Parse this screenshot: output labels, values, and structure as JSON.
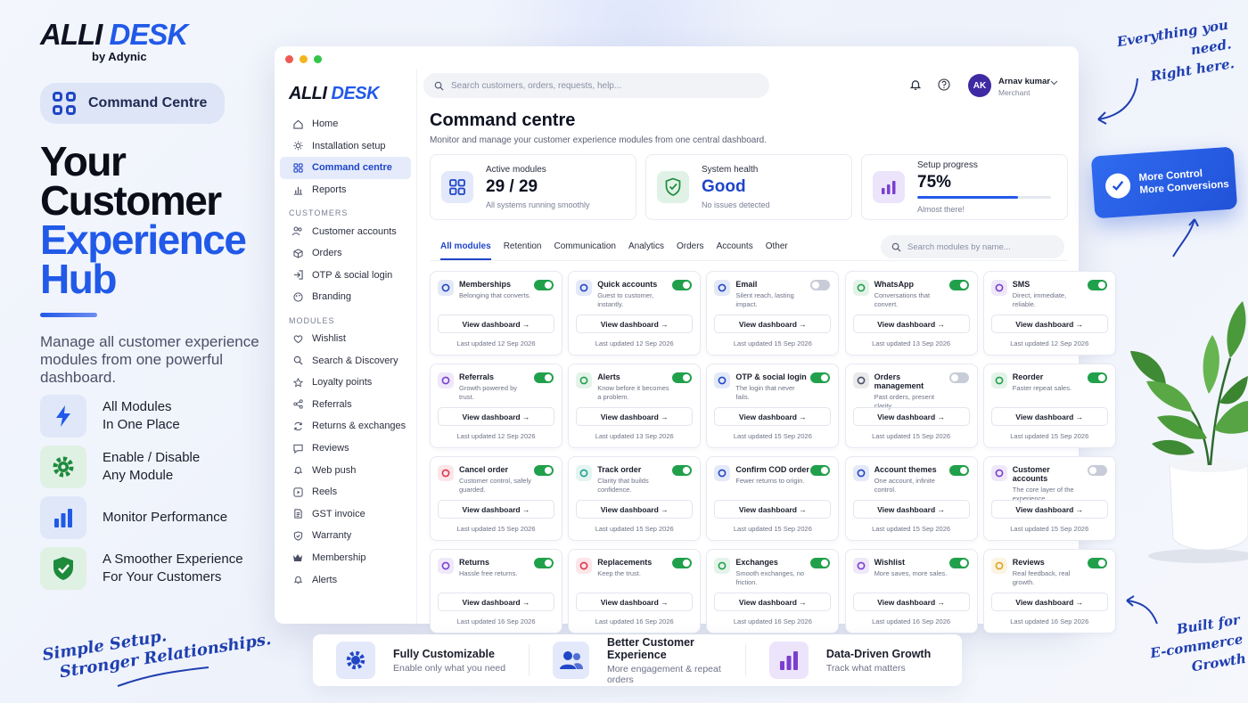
{
  "brand": {
    "logo_a": "ALLI",
    "logo_b": "DESK",
    "byline": "by Adynic"
  },
  "promo": {
    "pill": "Command Centre",
    "headline": [
      "Your",
      "Customer",
      "Experience",
      "Hub"
    ],
    "description": "Manage all customer experience modules from one powerful dashboard.",
    "features": [
      {
        "l1": "All Modules",
        "l2": "In One Place",
        "icon": "bolt-icon"
      },
      {
        "l1": "Enable / Disable",
        "l2": "Any Module",
        "icon": "gear-icon"
      },
      {
        "l1": "Monitor Performance",
        "l2": "",
        "icon": "bar-chart-icon"
      },
      {
        "l1": "A Smoother Experience",
        "l2": "For Your Customers",
        "icon": "shield-check-icon"
      }
    ],
    "script_bottom": [
      "Simple Setup.",
      "Stronger Relationships."
    ],
    "script_top": [
      "Everything you need.",
      "Right here."
    ],
    "script_right": [
      "Built for",
      "E-commerce Growth"
    ]
  },
  "badge": {
    "l1": "More Control",
    "l2": "More Conversions"
  },
  "window": {
    "search_placeholder": "Search customers, orders, requests, help...",
    "user": {
      "initials": "AK",
      "name": "Arnav kumar",
      "role": "Merchant"
    },
    "sidebar": {
      "top": [
        "Home",
        "Installation setup",
        "Command centre",
        "Reports"
      ],
      "customers_label": "CUSTOMERS",
      "customers": [
        "Customer accounts",
        "Orders",
        "OTP & social login",
        "Branding"
      ],
      "modules_label": "MODULES",
      "modules": [
        "Wishlist",
        "Search & Discovery",
        "Loyalty points",
        "Referrals",
        "Returns & exchanges",
        "Reviews",
        "Web push",
        "Reels",
        "GST invoice",
        "Warranty",
        "Membership",
        "Alerts"
      ]
    },
    "title": "Command centre",
    "subtitle": "Monitor and manage your customer experience modules from one central dashboard.",
    "stats": {
      "active": {
        "label": "Active modules",
        "value": "29 / 29",
        "note": "All systems running smoothly"
      },
      "health": {
        "label": "System health",
        "value": "Good",
        "note": "No issues detected"
      },
      "setup": {
        "label": "Setup progress",
        "value": "75%",
        "progress": 0.75,
        "note": "Almost there!"
      }
    },
    "tabs": [
      "All modules",
      "Retention",
      "Communication",
      "Analytics",
      "Orders",
      "Accounts",
      "Other"
    ],
    "module_search_placeholder": "Search modules by name...",
    "view_label": "View dashboard →",
    "modules": [
      {
        "name": "Memberships",
        "desc": "Belonging that converts.",
        "on": true,
        "updated": "Last updated 12 Sep 2026",
        "color": "#2146c6",
        "icon": "crown-icon"
      },
      {
        "name": "Quick accounts",
        "desc": "Guest to customer, instantly.",
        "on": true,
        "updated": "Last updated 12 Sep 2026",
        "color": "#2146c6",
        "icon": "users-icon"
      },
      {
        "name": "Email",
        "desc": "Silent reach, lasting impact.",
        "on": false,
        "updated": "Last updated 15 Sep 2026",
        "color": "#2146c6",
        "icon": "message-icon"
      },
      {
        "name": "WhatsApp",
        "desc": "Conversations that convert.",
        "on": true,
        "updated": "Last updated 13 Sep 2026",
        "color": "#21a04b",
        "icon": "whatsapp-icon"
      },
      {
        "name": "SMS",
        "desc": "Direct, immediate, reliable.",
        "on": true,
        "updated": "Last updated 12 Sep 2026",
        "color": "#7a3fd0",
        "icon": "sms-icon"
      },
      {
        "name": "Referrals",
        "desc": "Growth powered by trust.",
        "on": true,
        "updated": "Last updated 12 Sep 2026",
        "color": "#7a3fd0",
        "icon": "share-icon"
      },
      {
        "name": "Alerts",
        "desc": "Know before it becomes a problem.",
        "on": true,
        "updated": "Last updated 13 Sep 2026",
        "color": "#21a04b",
        "icon": "bell-icon"
      },
      {
        "name": "OTP & social login",
        "desc": "The login that never fails.",
        "on": true,
        "updated": "Last updated 15 Sep 2026",
        "color": "#2146c6",
        "icon": "login-icon"
      },
      {
        "name": "Orders management",
        "desc": "Past orders, present clarity.",
        "on": false,
        "updated": "Last updated 15 Sep 2026",
        "color": "#4a4f66",
        "icon": "box-icon"
      },
      {
        "name": "Reorder",
        "desc": "Faster repeat sales.",
        "on": true,
        "updated": "Last updated 15 Sep 2026",
        "color": "#21a04b",
        "icon": "refresh-icon"
      },
      {
        "name": "Cancel order",
        "desc": "Customer control, safely guarded.",
        "on": true,
        "updated": "Last updated 15 Sep 2026",
        "color": "#e0344a",
        "icon": "cancel-icon"
      },
      {
        "name": "Track order",
        "desc": "Clarity that builds confidence.",
        "on": true,
        "updated": "Last updated 15 Sep 2026",
        "color": "#1fa38c",
        "icon": "track-icon"
      },
      {
        "name": "Confirm COD order",
        "desc": "Fewer returns to origin.",
        "on": true,
        "updated": "Last updated 15 Sep 2026",
        "color": "#2146c6",
        "icon": "shield-check-icon"
      },
      {
        "name": "Account themes",
        "desc": "One account, infinite control.",
        "on": true,
        "updated": "Last updated 15 Sep 2026",
        "color": "#2146c6",
        "icon": "palette-icon"
      },
      {
        "name": "Customer accounts",
        "desc": "The core layer of the experience.",
        "on": false,
        "updated": "Last updated 15 Sep 2026",
        "color": "#7a3fd0",
        "icon": "users-icon"
      },
      {
        "name": "Returns",
        "desc": "Hassle free returns.",
        "on": true,
        "updated": "Last updated 16 Sep 2026",
        "color": "#7a3fd0",
        "icon": "return-icon"
      },
      {
        "name": "Replacements",
        "desc": "Keep the trust.",
        "on": true,
        "updated": "Last updated 16 Sep 2026",
        "color": "#e0344a",
        "icon": "replace-icon"
      },
      {
        "name": "Exchanges",
        "desc": "Smooth exchanges, no friction.",
        "on": true,
        "updated": "Last updated 16 Sep 2026",
        "color": "#21a04b",
        "icon": "exchange-icon"
      },
      {
        "name": "Wishlist",
        "desc": "More saves, more sales.",
        "on": true,
        "updated": "Last updated 16 Sep 2026",
        "color": "#7a3fd0",
        "icon": "heart-icon"
      },
      {
        "name": "Reviews",
        "desc": "Real feedback, real growth.",
        "on": true,
        "updated": "Last updated 16 Sep 2026",
        "color": "#e0a21a",
        "icon": "star-icon"
      }
    ]
  },
  "bottom_bar": [
    {
      "title": "Fully Customizable",
      "sub": "Enable only what you need",
      "icon": "puzzle-gear-icon"
    },
    {
      "title": "Better Customer Experience",
      "sub": "More engagement & repeat orders",
      "icon": "people-icon"
    },
    {
      "title": "Data-Driven Growth",
      "sub": "Track what matters",
      "icon": "bar-chart-icon"
    }
  ]
}
